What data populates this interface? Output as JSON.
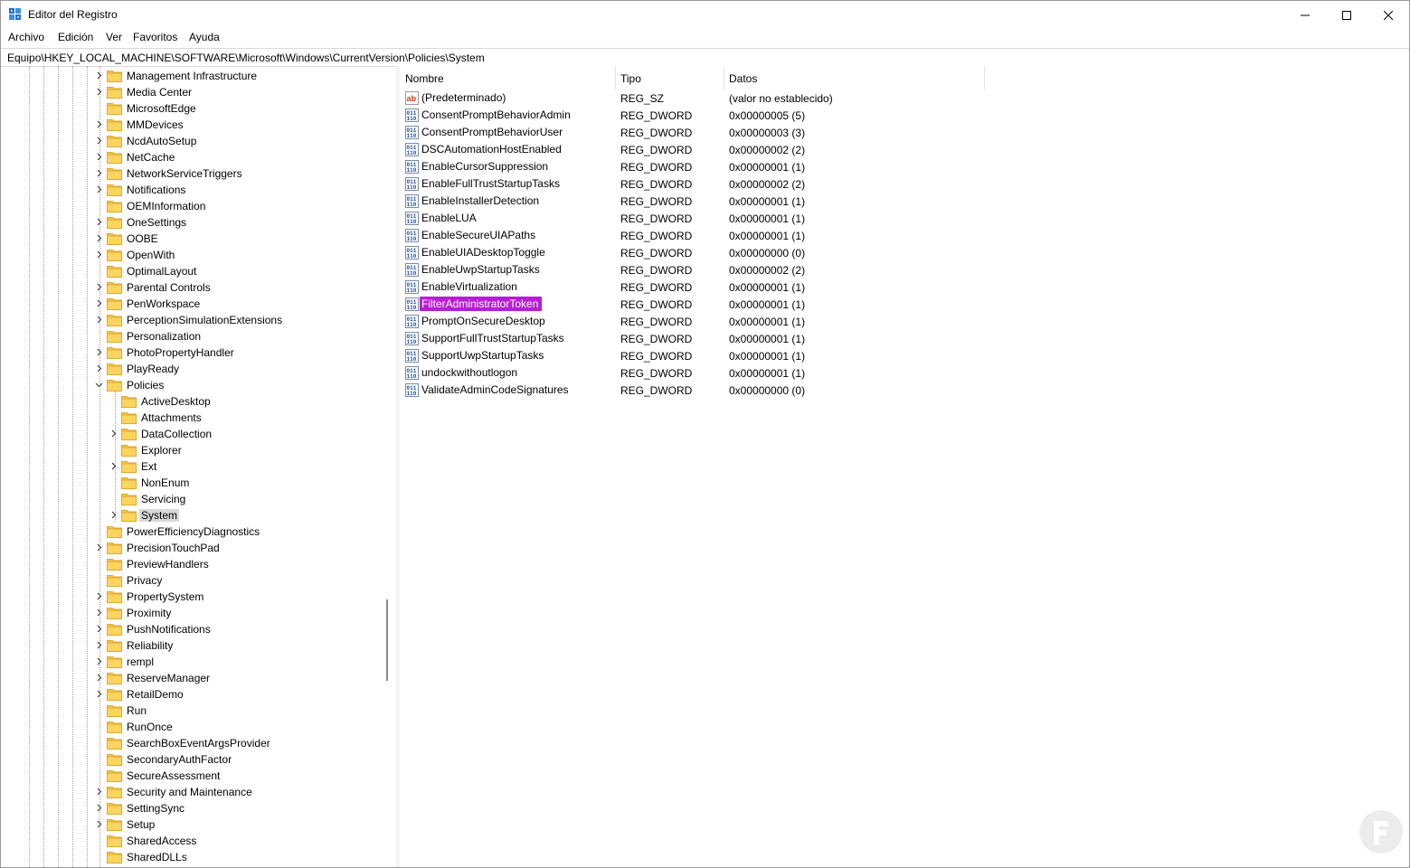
{
  "window": {
    "title": "Editor del Registro",
    "controls": [
      "minimize",
      "maximize",
      "close"
    ]
  },
  "menu": [
    "Archivo",
    "Edición",
    "Ver",
    "Favoritos",
    "Ayuda"
  ],
  "address": "Equipo\\HKEY_LOCAL_MACHINE\\SOFTWARE\\Microsoft\\Windows\\CurrentVersion\\Policies\\System",
  "tree": [
    {
      "label": "Management Infrastructure",
      "level": 1,
      "expander": "collapsed"
    },
    {
      "label": "Media Center",
      "level": 1,
      "expander": "collapsed"
    },
    {
      "label": "MicrosoftEdge",
      "level": 1,
      "expander": "none"
    },
    {
      "label": "MMDevices",
      "level": 1,
      "expander": "collapsed"
    },
    {
      "label": "NcdAutoSetup",
      "level": 1,
      "expander": "collapsed"
    },
    {
      "label": "NetCache",
      "level": 1,
      "expander": "collapsed"
    },
    {
      "label": "NetworkServiceTriggers",
      "level": 1,
      "expander": "collapsed"
    },
    {
      "label": "Notifications",
      "level": 1,
      "expander": "collapsed"
    },
    {
      "label": "OEMInformation",
      "level": 1,
      "expander": "none"
    },
    {
      "label": "OneSettings",
      "level": 1,
      "expander": "collapsed"
    },
    {
      "label": "OOBE",
      "level": 1,
      "expander": "collapsed"
    },
    {
      "label": "OpenWith",
      "level": 1,
      "expander": "collapsed"
    },
    {
      "label": "OptimalLayout",
      "level": 1,
      "expander": "none"
    },
    {
      "label": "Parental Controls",
      "level": 1,
      "expander": "collapsed"
    },
    {
      "label": "PenWorkspace",
      "level": 1,
      "expander": "collapsed"
    },
    {
      "label": "PerceptionSimulationExtensions",
      "level": 1,
      "expander": "collapsed"
    },
    {
      "label": "Personalization",
      "level": 1,
      "expander": "none"
    },
    {
      "label": "PhotoPropertyHandler",
      "level": 1,
      "expander": "collapsed"
    },
    {
      "label": "PlayReady",
      "level": 1,
      "expander": "collapsed"
    },
    {
      "label": "Policies",
      "level": 1,
      "expander": "expanded"
    },
    {
      "label": "ActiveDesktop",
      "level": 2,
      "expander": "none"
    },
    {
      "label": "Attachments",
      "level": 2,
      "expander": "none"
    },
    {
      "label": "DataCollection",
      "level": 2,
      "expander": "collapsed"
    },
    {
      "label": "Explorer",
      "level": 2,
      "expander": "none"
    },
    {
      "label": "Ext",
      "level": 2,
      "expander": "collapsed"
    },
    {
      "label": "NonEnum",
      "level": 2,
      "expander": "none"
    },
    {
      "label": "Servicing",
      "level": 2,
      "expander": "none"
    },
    {
      "label": "System",
      "level": 2,
      "expander": "collapsed",
      "selected": true
    },
    {
      "label": "PowerEfficiencyDiagnostics",
      "level": 1,
      "expander": "none"
    },
    {
      "label": "PrecisionTouchPad",
      "level": 1,
      "expander": "collapsed"
    },
    {
      "label": "PreviewHandlers",
      "level": 1,
      "expander": "none"
    },
    {
      "label": "Privacy",
      "level": 1,
      "expander": "none"
    },
    {
      "label": "PropertySystem",
      "level": 1,
      "expander": "collapsed"
    },
    {
      "label": "Proximity",
      "level": 1,
      "expander": "collapsed"
    },
    {
      "label": "PushNotifications",
      "level": 1,
      "expander": "collapsed"
    },
    {
      "label": "Reliability",
      "level": 1,
      "expander": "collapsed"
    },
    {
      "label": "rempl",
      "level": 1,
      "expander": "collapsed"
    },
    {
      "label": "ReserveManager",
      "level": 1,
      "expander": "collapsed"
    },
    {
      "label": "RetailDemo",
      "level": 1,
      "expander": "collapsed"
    },
    {
      "label": "Run",
      "level": 1,
      "expander": "none"
    },
    {
      "label": "RunOnce",
      "level": 1,
      "expander": "none"
    },
    {
      "label": "SearchBoxEventArgsProvider",
      "level": 1,
      "expander": "none"
    },
    {
      "label": "SecondaryAuthFactor",
      "level": 1,
      "expander": "none"
    },
    {
      "label": "SecureAssessment",
      "level": 1,
      "expander": "none"
    },
    {
      "label": "Security and Maintenance",
      "level": 1,
      "expander": "collapsed"
    },
    {
      "label": "SettingSync",
      "level": 1,
      "expander": "collapsed"
    },
    {
      "label": "Setup",
      "level": 1,
      "expander": "collapsed"
    },
    {
      "label": "SharedAccess",
      "level": 1,
      "expander": "none"
    },
    {
      "label": "SharedDLLs",
      "level": 1,
      "expander": "none"
    }
  ],
  "columns": [
    "Nombre",
    "Tipo",
    "Datos"
  ],
  "values": [
    {
      "name": "(Predeterminado)",
      "type": "REG_SZ",
      "data": "(valor no establecido)",
      "icon": "string-value-icon"
    },
    {
      "name": "ConsentPromptBehaviorAdmin",
      "type": "REG_DWORD",
      "data": "0x00000005 (5)",
      "icon": "binary-value-icon"
    },
    {
      "name": "ConsentPromptBehaviorUser",
      "type": "REG_DWORD",
      "data": "0x00000003 (3)",
      "icon": "binary-value-icon"
    },
    {
      "name": "DSCAutomationHostEnabled",
      "type": "REG_DWORD",
      "data": "0x00000002 (2)",
      "icon": "binary-value-icon"
    },
    {
      "name": "EnableCursorSuppression",
      "type": "REG_DWORD",
      "data": "0x00000001 (1)",
      "icon": "binary-value-icon"
    },
    {
      "name": "EnableFullTrustStartupTasks",
      "type": "REG_DWORD",
      "data": "0x00000002 (2)",
      "icon": "binary-value-icon"
    },
    {
      "name": "EnableInstallerDetection",
      "type": "REG_DWORD",
      "data": "0x00000001 (1)",
      "icon": "binary-value-icon"
    },
    {
      "name": "EnableLUA",
      "type": "REG_DWORD",
      "data": "0x00000001 (1)",
      "icon": "binary-value-icon"
    },
    {
      "name": "EnableSecureUIAPaths",
      "type": "REG_DWORD",
      "data": "0x00000001 (1)",
      "icon": "binary-value-icon"
    },
    {
      "name": "EnableUIADesktopToggle",
      "type": "REG_DWORD",
      "data": "0x00000000 (0)",
      "icon": "binary-value-icon"
    },
    {
      "name": "EnableUwpStartupTasks",
      "type": "REG_DWORD",
      "data": "0x00000002 (2)",
      "icon": "binary-value-icon"
    },
    {
      "name": "EnableVirtualization",
      "type": "REG_DWORD",
      "data": "0x00000001 (1)",
      "icon": "binary-value-icon"
    },
    {
      "name": "FilterAdministratorToken",
      "type": "REG_DWORD",
      "data": "0x00000001 (1)",
      "icon": "binary-value-icon",
      "highlighted": true
    },
    {
      "name": "PromptOnSecureDesktop",
      "type": "REG_DWORD",
      "data": "0x00000001 (1)",
      "icon": "binary-value-icon"
    },
    {
      "name": "SupportFullTrustStartupTasks",
      "type": "REG_DWORD",
      "data": "0x00000001 (1)",
      "icon": "binary-value-icon"
    },
    {
      "name": "SupportUwpStartupTasks",
      "type": "REG_DWORD",
      "data": "0x00000001 (1)",
      "icon": "binary-value-icon"
    },
    {
      "name": "undockwithoutlogon",
      "type": "REG_DWORD",
      "data": "0x00000001 (1)",
      "icon": "binary-value-icon"
    },
    {
      "name": "ValidateAdminCodeSignatures",
      "type": "REG_DWORD",
      "data": "0x00000000 (0)",
      "icon": "binary-value-icon"
    }
  ],
  "colors": {
    "highlight": "#b61ed3",
    "selected_tree": "#d9d9d9",
    "folder": "#f8c648"
  }
}
